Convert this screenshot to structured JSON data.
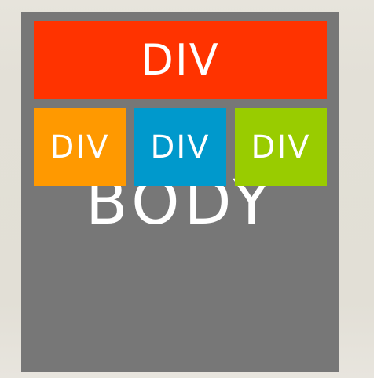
{
  "body_box": {
    "label": "BODY",
    "color": "#777777"
  },
  "divs": [
    {
      "label": "DIV",
      "color": "#ff3300"
    },
    {
      "label": "DIV",
      "color": "#ff9900"
    },
    {
      "label": "DIV",
      "color": "#0099cc"
    },
    {
      "label": "DIV",
      "color": "#99cc00"
    }
  ],
  "page": {
    "background_color": "#e3e0d7"
  }
}
